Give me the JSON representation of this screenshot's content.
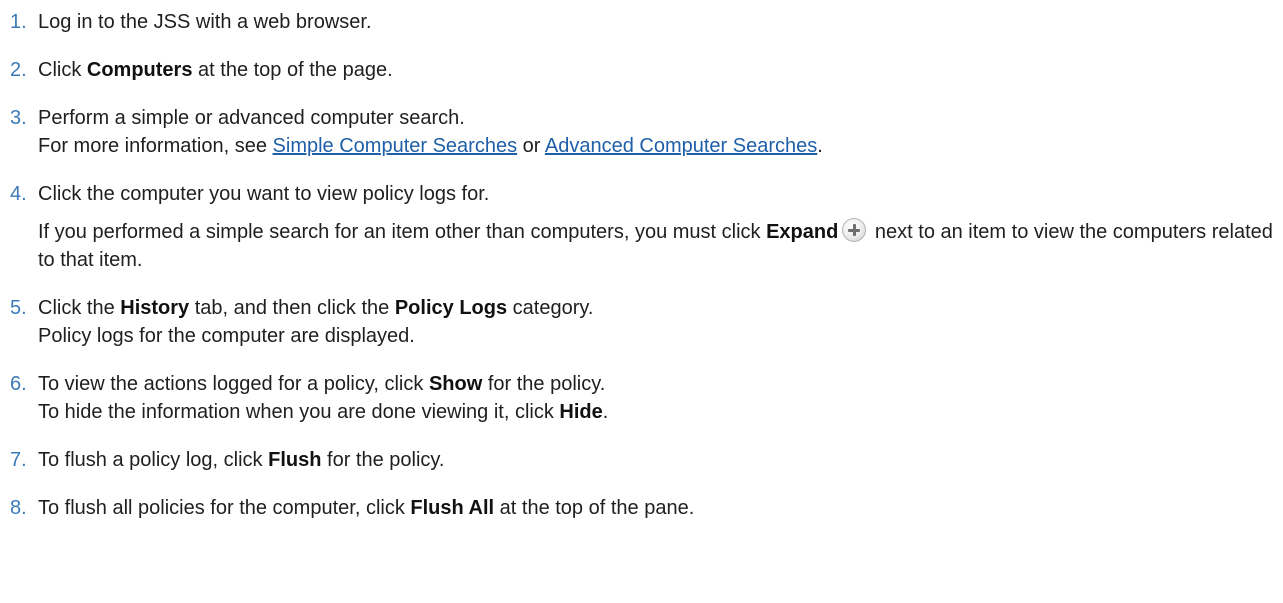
{
  "steps": [
    {
      "num": "1.",
      "text": "Log in to the JSS with a web browser."
    },
    {
      "num": "2.",
      "pre": "Click ",
      "bold": "Computers",
      "post": " at the top of the page."
    },
    {
      "num": "3.",
      "line1": "Perform a simple or advanced computer search.",
      "line2_pre": "For more information, see ",
      "link1": "Simple Computer Searches",
      "line2_mid": " or ",
      "link2": "Advanced Computer Searches",
      "line2_post": "."
    },
    {
      "num": "4.",
      "line1": "Click the computer you want to view policy logs for.",
      "para2_pre": "If you performed a simple search for an item other than computers, you must click ",
      "para2_bold": "Expand",
      "para2_icon": "expand-plus-icon",
      "para2_post": " next to an item to view the computers related to that item."
    },
    {
      "num": "5.",
      "pre": "Click the ",
      "bold1": "History",
      "mid": " tab, and then click the ",
      "bold2": "Policy Logs",
      "post": " category.",
      "line2": "Policy logs for the computer are displayed."
    },
    {
      "num": "6.",
      "pre": "To view the actions logged for a policy, click ",
      "bold1": "Show",
      "post": " for the policy.",
      "line2_pre": "To hide the information when you are done viewing it, click ",
      "bold2": "Hide",
      "line2_post": "."
    },
    {
      "num": "7.",
      "pre": "To flush a policy log, click ",
      "bold": "Flush",
      "post": " for the policy."
    },
    {
      "num": "8.",
      "pre": "To flush all policies for the computer, click ",
      "bold": "Flush All",
      "post": " at the top of the pane."
    }
  ],
  "colors": {
    "step_number": "#3c7ab8",
    "link": "#1f5fa8",
    "text": "#1f1f1f"
  }
}
